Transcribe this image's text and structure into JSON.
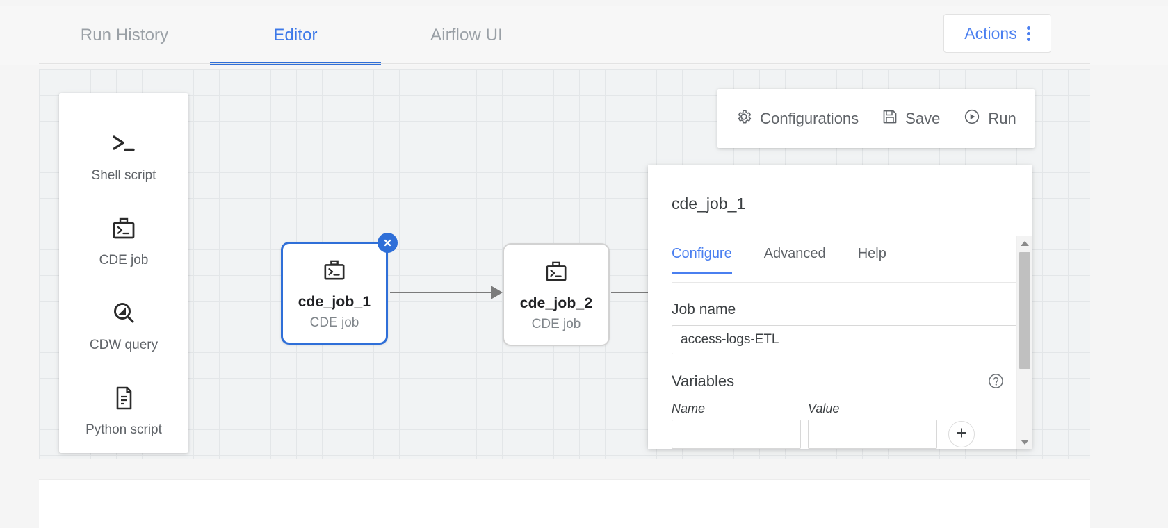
{
  "topbar": {
    "tabs": [
      {
        "label": "Run History",
        "active": false
      },
      {
        "label": "Editor",
        "active": true
      },
      {
        "label": "Airflow UI",
        "active": false
      }
    ],
    "actions_button": {
      "label": "Actions",
      "icon": "kebab-menu-icon"
    }
  },
  "palette": {
    "items": [
      {
        "label": "Shell script",
        "icon": "shell-prompt-icon"
      },
      {
        "label": "CDE job",
        "icon": "briefcase-terminal-icon"
      },
      {
        "label": "CDW query",
        "icon": "magnifier-query-icon"
      },
      {
        "label": "Python script",
        "icon": "document-lines-icon"
      }
    ]
  },
  "canvas": {
    "nodes": [
      {
        "title": "cde_job_1",
        "subtitle": "CDE job",
        "icon": "briefcase-terminal-icon",
        "selected": true,
        "close_icon": "close-icon"
      },
      {
        "title": "cde_job_2",
        "subtitle": "CDE job",
        "icon": "briefcase-terminal-icon",
        "selected": false
      }
    ]
  },
  "toolbar": {
    "configurations_label": "Configurations",
    "configurations_icon": "gear-icon",
    "save_label": "Save",
    "save_icon": "floppy-disk-icon",
    "run_label": "Run",
    "run_icon": "play-circle-icon"
  },
  "config_panel": {
    "title": "cde_job_1",
    "tabs": [
      {
        "label": "Configure",
        "active": true
      },
      {
        "label": "Advanced",
        "active": false
      },
      {
        "label": "Help",
        "active": false
      }
    ],
    "job_name": {
      "label": "Job name",
      "value": "access-logs-ETL",
      "placeholder": "Job name"
    },
    "variables": {
      "label": "Variables",
      "help_icon": "help-circle-icon",
      "columns": {
        "name": "Name",
        "value": "Value"
      },
      "rows": [
        {
          "name": "",
          "value": ""
        }
      ],
      "name_placeholder": "",
      "value_placeholder": "",
      "add_icon": "plus-icon"
    },
    "scrollbar": {
      "up_icon": "chevron-up-icon",
      "down_icon": "chevron-down-icon"
    }
  },
  "colors": {
    "accent_blue": "#2f6fd8",
    "link_blue": "#4a7ff0",
    "text_primary": "#3c4043",
    "text_muted": "#80868b",
    "canvas_grid": "#e3e6e8"
  }
}
